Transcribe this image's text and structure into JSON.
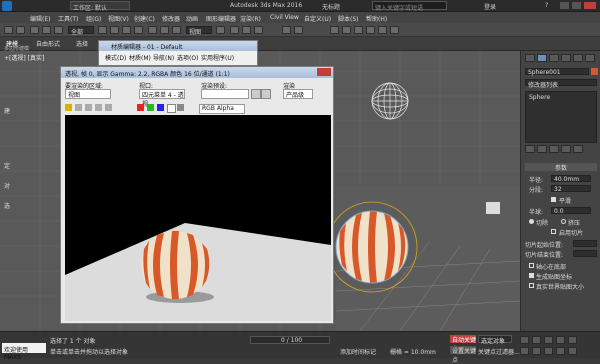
{
  "app": {
    "title": "Autodesk 3ds Max 2016",
    "file": "无标题",
    "workspace": "工作区: 默认",
    "search_placeholder": "键入关键字或短语",
    "sign_in": "登录",
    "help": "?"
  },
  "menu": [
    "编辑(E)",
    "工具(T)",
    "组(G)",
    "视图(V)",
    "创建(C)",
    "修改器",
    "动画",
    "图形编辑器",
    "渲染(R)",
    "Civil View",
    "自定义(U)",
    "脚本(S)",
    "帮助(H)"
  ],
  "toolbar": {
    "selection_filter": "全部",
    "view_dropdown": "视图"
  },
  "ribbon": {
    "tabs": [
      "建模",
      "自由形式",
      "选择"
    ],
    "sub_label": "多边形建模"
  },
  "viewport": {
    "label": "+[透视] [真实]",
    "side_labels": [
      "建",
      "定",
      "对",
      "选"
    ]
  },
  "material_editor": {
    "title": "材质编辑器 - 01 - Default",
    "menus": [
      "模式(D)",
      "材质(M)",
      "导航(N)",
      "选项(O)",
      "实用程序(U)"
    ]
  },
  "render_window": {
    "title": "透视, 帧 0, 显示 Gamma: 2.2, RGBA 颜色 16 位/通道 (1:1)",
    "area_label": "要渲染的区域:",
    "area_value": "视图",
    "viewport_label": "视口:",
    "viewport_value": "四元菜单 4 - 透视",
    "preset_label": "渲染预设:",
    "preset_value": "",
    "render_button": "渲染",
    "production_value": "产品级",
    "channel_value": "RGB Alpha"
  },
  "command_panel": {
    "object_name": "Sphere001",
    "modifier_list": "修改器列表",
    "stack_item": "Sphere",
    "rollout": "参数",
    "params": [
      {
        "label": "半径:",
        "value": "40.0mm"
      },
      {
        "label": "分段:",
        "value": "32"
      }
    ],
    "smooth": "平滑",
    "hemisphere_label": "半球:",
    "hemisphere_value": "0.0",
    "chop": "切除",
    "squash": "挤压",
    "slice_on": "启用切片",
    "slice_from": "切片起始位置:",
    "slice_to": "切片结束位置:",
    "base_to_pivot": "轴心在底部",
    "gen_map": "生成贴图坐标",
    "real_world": "真实世界贴图大小"
  },
  "status": {
    "script_label": "欢迎使用 MAXS",
    "selected": "选择了 1 个 对象",
    "click_hint": "单击或单击并拖动以选择对象",
    "frame": "0 / 100",
    "grid": "栅格 = 10.0mm",
    "auto_key": "自动关键点",
    "set_key": "设置关键点",
    "selected_obj": "选定对象",
    "key_filter": "关键点过滤器...",
    "add_time_tag": "添加时间标记"
  },
  "colors": {
    "accent": "#2b7bd5",
    "sphere_orange": "#d9582a",
    "sphere_cream": "#efe2c8",
    "bg_dark": "#3a3a3a"
  }
}
